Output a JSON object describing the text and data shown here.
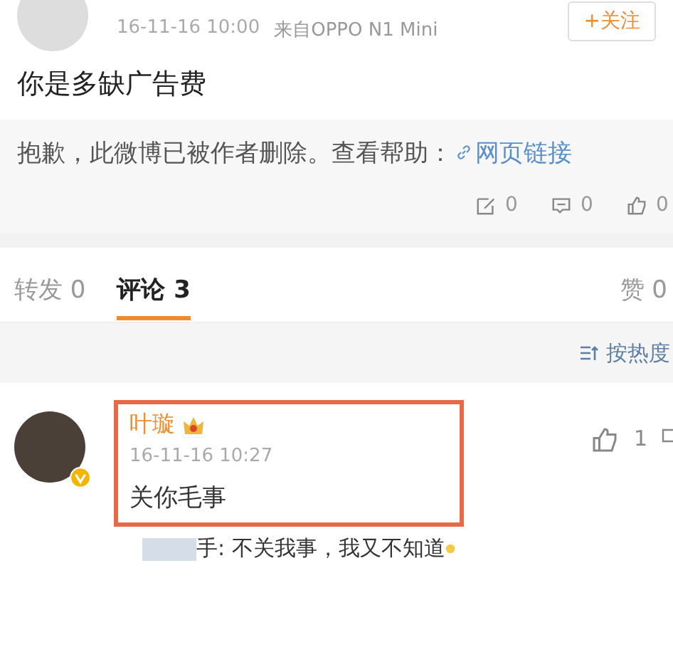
{
  "post": {
    "follow_button": "+关注",
    "time": "16-11-16 10:00",
    "source": "来自OPPO N1 Mini",
    "text": "你是多缺广告费"
  },
  "deleted_notice": {
    "text": "抱歉，此微博已被作者删除。查看帮助：",
    "link": "网页链接"
  },
  "actions": [
    {
      "kind": "repost",
      "count": "0"
    },
    {
      "kind": "comment",
      "count": "0"
    },
    {
      "kind": "like",
      "count": "0"
    }
  ],
  "tabs": [
    {
      "label": "转发 0",
      "selected": false
    },
    {
      "label": "评论 3",
      "selected": true
    }
  ],
  "likes_tab": "赞 0",
  "sort": "按热度",
  "comment": {
    "name": "叶璇",
    "verified": true,
    "time": "16-11-16 10:27",
    "text": "关你毛事",
    "likes": "1",
    "highlighted": true,
    "reply": {
      "text": "手: 不关我事，我又不知道"
    }
  }
}
